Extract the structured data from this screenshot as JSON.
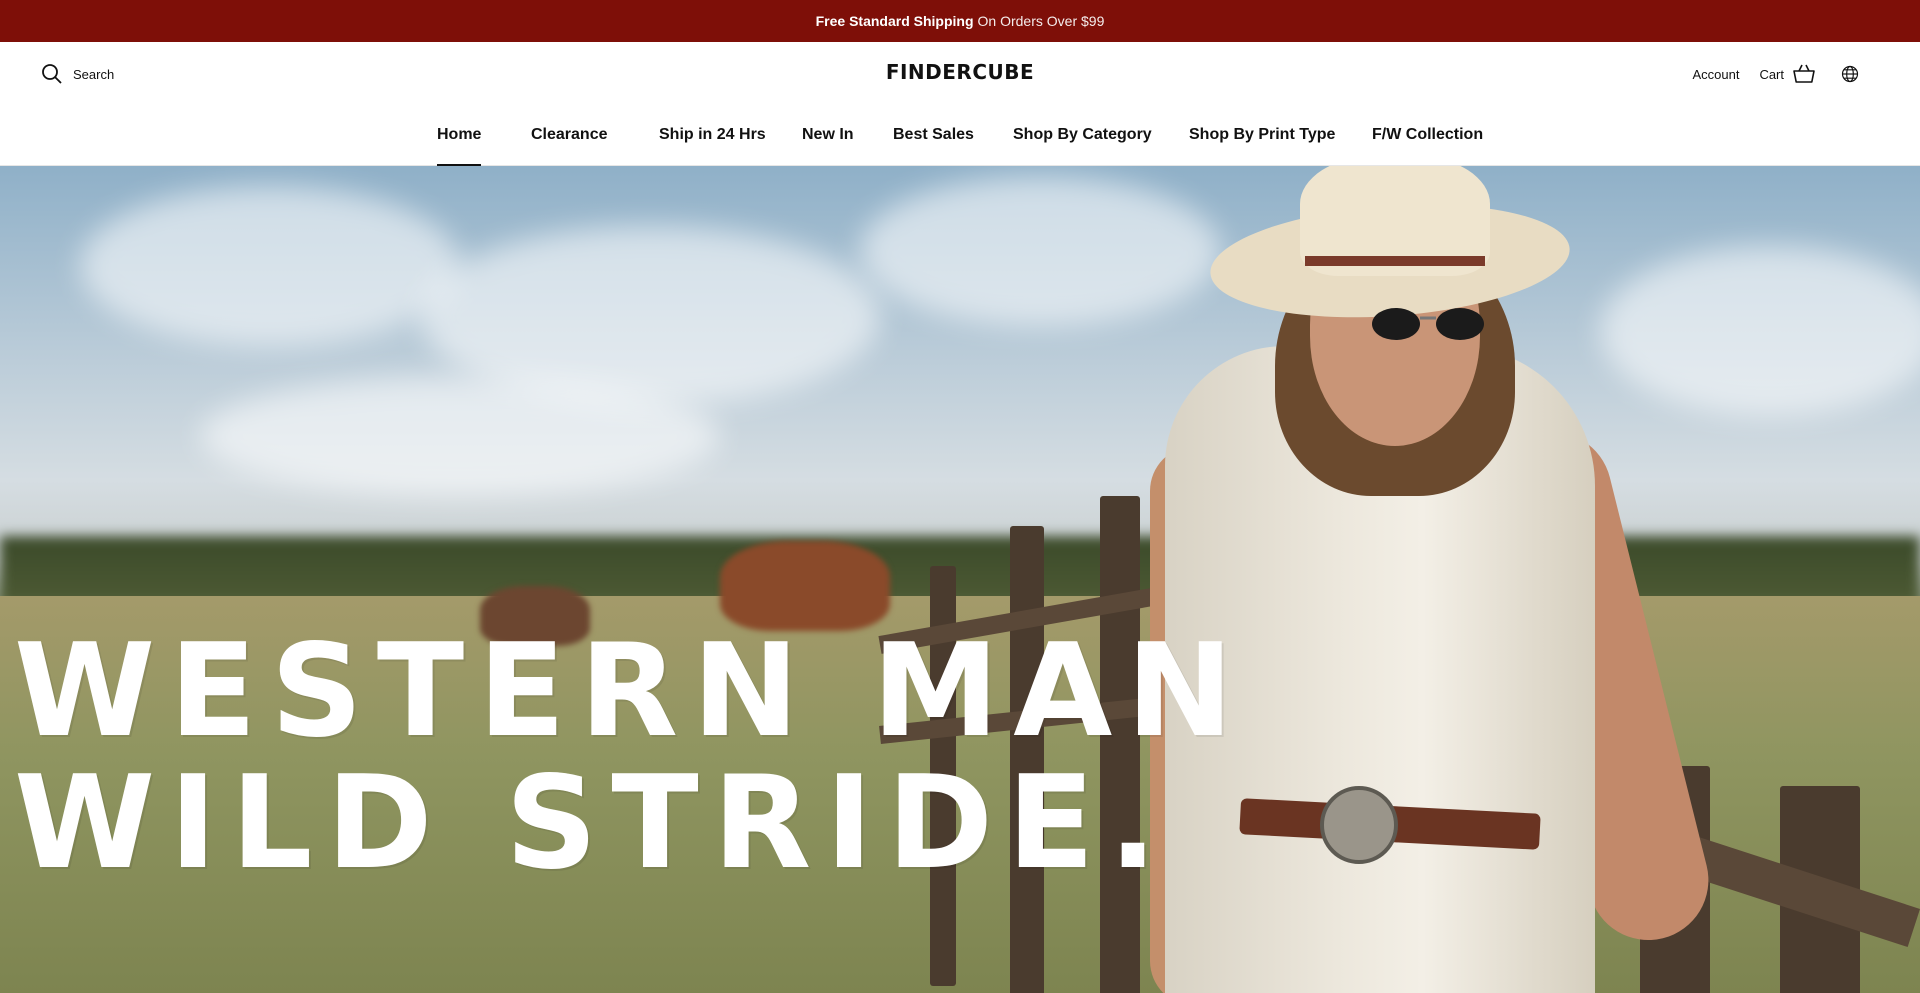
{
  "announcement": {
    "bold": "Free Standard Shipping",
    "rest": "On Orders Over $99"
  },
  "header": {
    "search_label": "Search",
    "logo": "FINDERCUBE",
    "account_label": "Account",
    "cart_label": "Cart"
  },
  "nav": {
    "items": [
      {
        "label": "Home",
        "active": true
      },
      {
        "label": "Clearance"
      },
      {
        "label": "Ship in 24 Hrs"
      },
      {
        "label": "New In"
      },
      {
        "label": "Best Sales"
      },
      {
        "label": "Shop By Category"
      },
      {
        "label": "Shop By Print Type"
      },
      {
        "label": "F/W Collection"
      }
    ]
  },
  "hero": {
    "title_line1": "WESTERN MAN",
    "title_line2": "WILD STRIDE."
  },
  "colors": {
    "announcement_bg": "#7e0f08",
    "text": "#111111",
    "hero_title": "#ffffff"
  },
  "icons": {
    "search": "search-icon",
    "cart": "cart-icon",
    "globe": "globe-icon"
  }
}
